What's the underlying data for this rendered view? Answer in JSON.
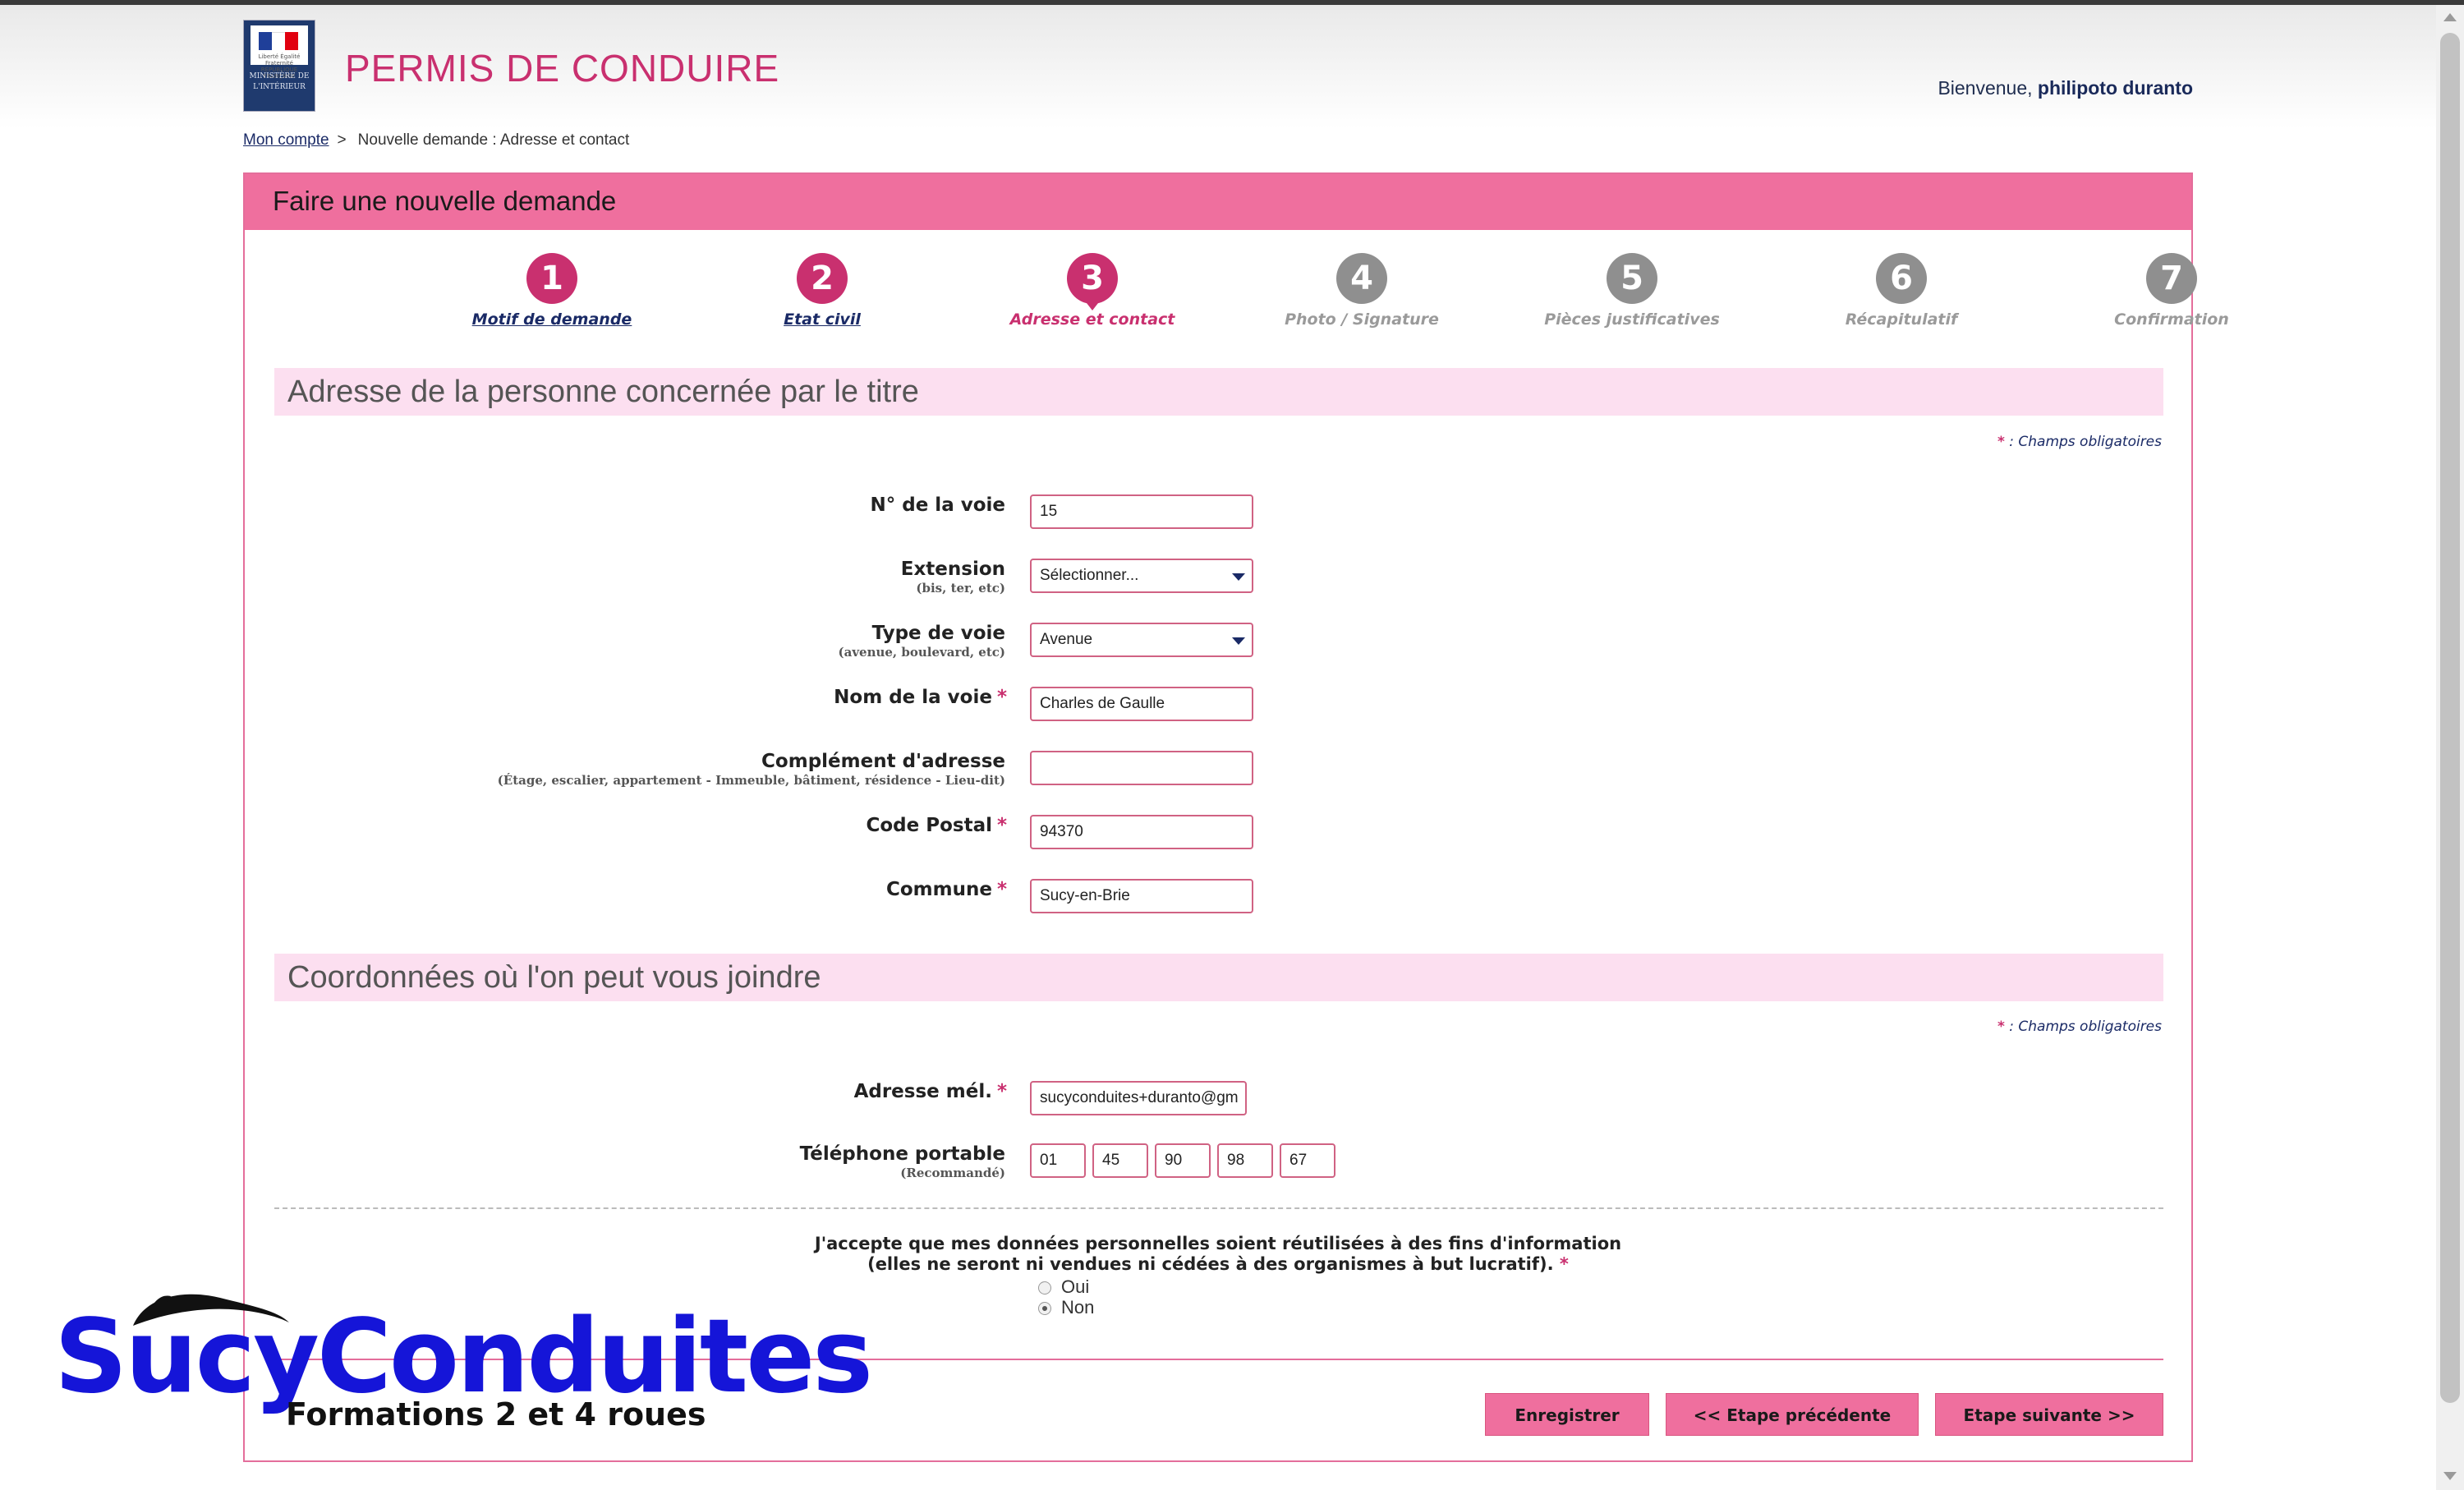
{
  "header": {
    "logo_text": "MINISTÈRE DE L'INTÉRIEUR",
    "logo_motto": "Liberté Égalité Fraternité RÉPUBLIQUE FRANÇAISE",
    "app_title": "PERMIS DE CONDUIRE",
    "welcome_prefix": "Bienvenue,",
    "user_name": "philipoto duranto"
  },
  "breadcrumb": {
    "home_link": "Mon compte",
    "separator": ">",
    "current": "Nouvelle demande : Adresse et contact"
  },
  "panel": {
    "title": "Faire une nouvelle demande"
  },
  "steps": [
    {
      "num": "1",
      "label": "Motif de demande",
      "state": "done"
    },
    {
      "num": "2",
      "label": "Etat civil",
      "state": "done"
    },
    {
      "num": "3",
      "label": "Adresse et contact",
      "state": "current"
    },
    {
      "num": "4",
      "label": "Photo / Signature",
      "state": "todo"
    },
    {
      "num": "5",
      "label": "Pièces justificatives",
      "state": "todo"
    },
    {
      "num": "6",
      "label": "Récapitulatif",
      "state": "todo"
    },
    {
      "num": "7",
      "label": "Confirmation",
      "state": "todo"
    }
  ],
  "address_section": {
    "title": "Adresse de la personne concernée par le titre",
    "required_note": ": Champs obligatoires",
    "star": "*",
    "fields": {
      "street_number": {
        "label": "N° de la voie",
        "value": "15"
      },
      "extension": {
        "label": "Extension",
        "sub": "(bis, ter, etc)",
        "value": "Sélectionner..."
      },
      "street_type": {
        "label": "Type de voie",
        "sub": "(avenue, boulevard, etc)",
        "value": "Avenue"
      },
      "street_name": {
        "label": "Nom de la voie",
        "value": "Charles de Gaulle"
      },
      "address_complement": {
        "label": "Complément d'adresse",
        "sub": "(Étage, escalier, appartement - Immeuble, bâtiment, résidence - Lieu-dit)",
        "value": ""
      },
      "postal_code": {
        "label": "Code Postal",
        "value": "94370"
      },
      "city": {
        "label": "Commune",
        "value": "Sucy-en-Brie"
      }
    }
  },
  "contact_section": {
    "title": "Coordonnées où l'on peut vous joindre",
    "required_note": ": Champs obligatoires",
    "email": {
      "label": "Adresse mél.",
      "value": "sucyconduites+duranto@gm"
    },
    "phone": {
      "label": "Téléphone portable",
      "sub": "(Recommandé)",
      "parts": [
        "01",
        "45",
        "90",
        "98",
        "67"
      ]
    }
  },
  "consent": {
    "line1": "J'accepte que mes données personnelles soient réutilisées à des fins d'information",
    "line2": "(elles ne seront ni vendues ni cédées à des organismes à but lucratif).",
    "options": [
      "Oui",
      "Non"
    ],
    "selected": "Non"
  },
  "actions": {
    "save": "Enregistrer",
    "previous": "<<  Etape précédente",
    "next": "Etape suivante  >>"
  },
  "watermark": {
    "name": "SucyConduites",
    "tagline": "Formations 2 et 4 roues"
  },
  "colors": {
    "accent": "#ef6f9e",
    "brand_pink": "#c9306f",
    "section_bg": "#fcdff0",
    "watermark_blue": "#1515d8"
  }
}
